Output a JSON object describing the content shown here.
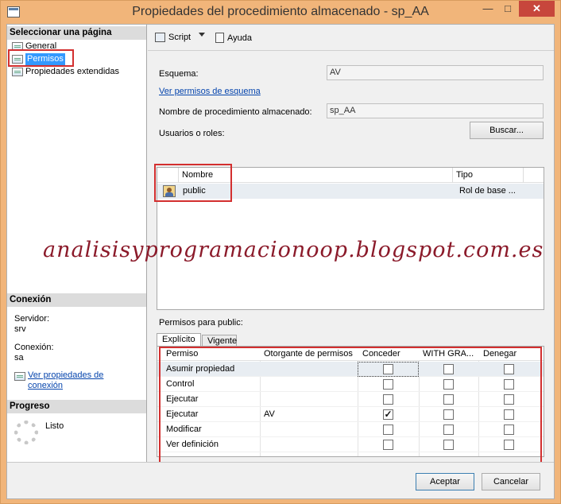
{
  "window": {
    "title": "Propiedades del procedimiento almacenado - sp_AA",
    "minimize": "—",
    "maximize": "□",
    "close": "✕"
  },
  "left": {
    "select_page_header": "Seleccionar una página",
    "pages": [
      {
        "label": "General",
        "icon": "page-icon"
      },
      {
        "label": "Permisos",
        "icon": "page-icon",
        "selected": true
      },
      {
        "label": "Propiedades extendidas",
        "icon": "page-icon"
      }
    ],
    "connection_header": "Conexión",
    "server_label": "Servidor:",
    "server_value": "srv",
    "connection_label": "Conexión:",
    "connection_value": "sa",
    "view_connection_props_line1": "Ver propiedades de",
    "view_connection_props_line2": "conexión",
    "progress_header": "Progreso",
    "progress_status": "Listo"
  },
  "toolbar": {
    "script_label": "Script",
    "help_label": "Ayuda"
  },
  "form": {
    "schema_label": "Esquema:",
    "schema_value": "AV",
    "view_schema_permissions": "Ver permisos de esquema",
    "proc_name_label": "Nombre de procedimiento almacenado:",
    "proc_name_value": "sp_AA",
    "users_roles_label": "Usuarios o roles:",
    "search_button": "Buscar..."
  },
  "users_grid": {
    "columns": [
      "Nombre",
      "Tipo"
    ],
    "rows": [
      {
        "name": "public",
        "type": "Rol de base ..."
      }
    ]
  },
  "watermark": "analisisyprogramacionoop.blogspot.com.es",
  "permissions": {
    "label": "Permisos para public:",
    "tabs": [
      "Explícito",
      "Vigente"
    ],
    "columns": [
      "Permiso",
      "Otorgante de permisos",
      "Conceder",
      "WITH GRA...",
      "Denegar"
    ],
    "rows": [
      {
        "permission": "Asumir propiedad",
        "grantor": "",
        "grant": false,
        "with_grant": false,
        "deny": false
      },
      {
        "permission": "Control",
        "grantor": "",
        "grant": false,
        "with_grant": false,
        "deny": false
      },
      {
        "permission": "Ejecutar",
        "grantor": "",
        "grant": false,
        "with_grant": false,
        "deny": false
      },
      {
        "permission": "Ejecutar",
        "grantor": "AV",
        "grant": true,
        "with_grant": false,
        "deny": false
      },
      {
        "permission": "Modificar",
        "grantor": "",
        "grant": false,
        "with_grant": false,
        "deny": false
      },
      {
        "permission": "Ver definición",
        "grantor": "",
        "grant": false,
        "with_grant": false,
        "deny": false
      }
    ]
  },
  "footer": {
    "ok_button": "Aceptar",
    "cancel_button": "Cancelar"
  },
  "colors": {
    "titlebar": "#f1b57a",
    "close_button": "#c7463c",
    "selection": "#3399ff",
    "highlight_box": "#d32f2f",
    "watermark": "#8b1a2a"
  }
}
